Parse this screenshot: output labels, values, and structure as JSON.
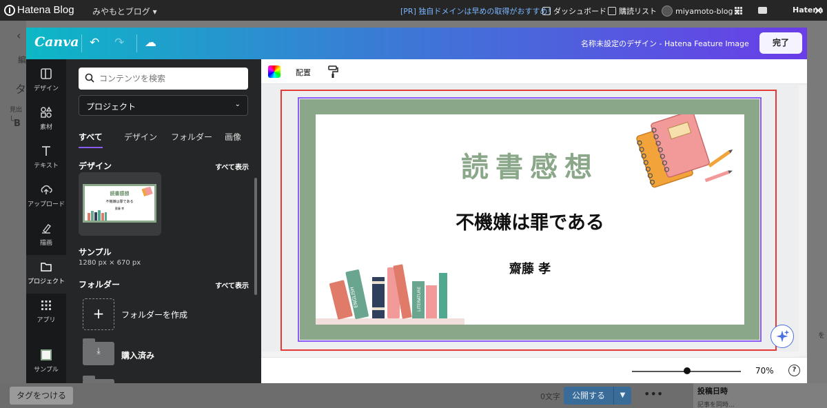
{
  "hatena": {
    "logo": "Hatena Blog",
    "blog_menu": "みやもとブログ ▾",
    "promo": "[PR] 独自ドメインは早めの取得がおすすめ！",
    "dashboard": "ダッシュボード",
    "reading_list": "購読リスト",
    "user": "miyamoto-blog ▾",
    "brand_cut": "Hatena",
    "close_glyph": "✕"
  },
  "editor_bg": {
    "back_glyph": "‹",
    "tab_fragment": "編",
    "tag_placeholder_fragment": "タ",
    "heading_fragment": "見出し",
    "bold": "B",
    "tag_button": "タグをつける",
    "word_count": "0文字",
    "publish": "公開する",
    "more_glyph": "•••",
    "side_heading": "投稿日時",
    "side_sub": "記事を同時...",
    "side_fragment": "を"
  },
  "canva": {
    "logo": "Canva",
    "undo_glyph": "↶",
    "redo_glyph": "↷",
    "cloud_glyph": "☁",
    "doc_title": "名称未設定のデザイン - Hatena Feature Image",
    "done_button": "完了",
    "rail": [
      {
        "label": "デザイン",
        "icon": "layout-icon"
      },
      {
        "label": "素材",
        "icon": "shapes-icon"
      },
      {
        "label": "テキスト",
        "icon": "text-icon"
      },
      {
        "label": "アップロード",
        "icon": "cloud-upload-icon"
      },
      {
        "label": "描画",
        "icon": "draw-icon"
      },
      {
        "label": "プロジェクト",
        "icon": "folder-icon",
        "active": true
      },
      {
        "label": "アプリ",
        "icon": "apps-icon"
      },
      {
        "label": "サンプル",
        "icon": "thumbnail-icon"
      }
    ],
    "search": {
      "placeholder": "コンテンツを検索"
    },
    "project_select": "プロジェクト",
    "tabs": [
      "すべて",
      "デザイン",
      "フォルダー",
      "画像"
    ],
    "sections": {
      "designs": "デザイン",
      "folders": "フォルダー",
      "show_all": "すべて表示"
    },
    "design_item": {
      "name": "サンプル",
      "size": "1280 px × 670 px"
    },
    "create_folder": "フォルダーを作成",
    "purchased_folder": "購入済み",
    "toolbar": {
      "arrange": "配置"
    },
    "zoom": {
      "percent": "70%",
      "level": 0.47
    },
    "help_glyph": "?",
    "design": {
      "title": "読書感想",
      "book_title": "不機嫌は罪である",
      "author": "齋藤 孝",
      "book_spine_labels": [
        "ENGLISH",
        "LITERATURE"
      ]
    },
    "colors": {
      "sage": "#8aa78a",
      "selection_red": "#e53935",
      "selection_purple": "#8b5cf6"
    }
  }
}
